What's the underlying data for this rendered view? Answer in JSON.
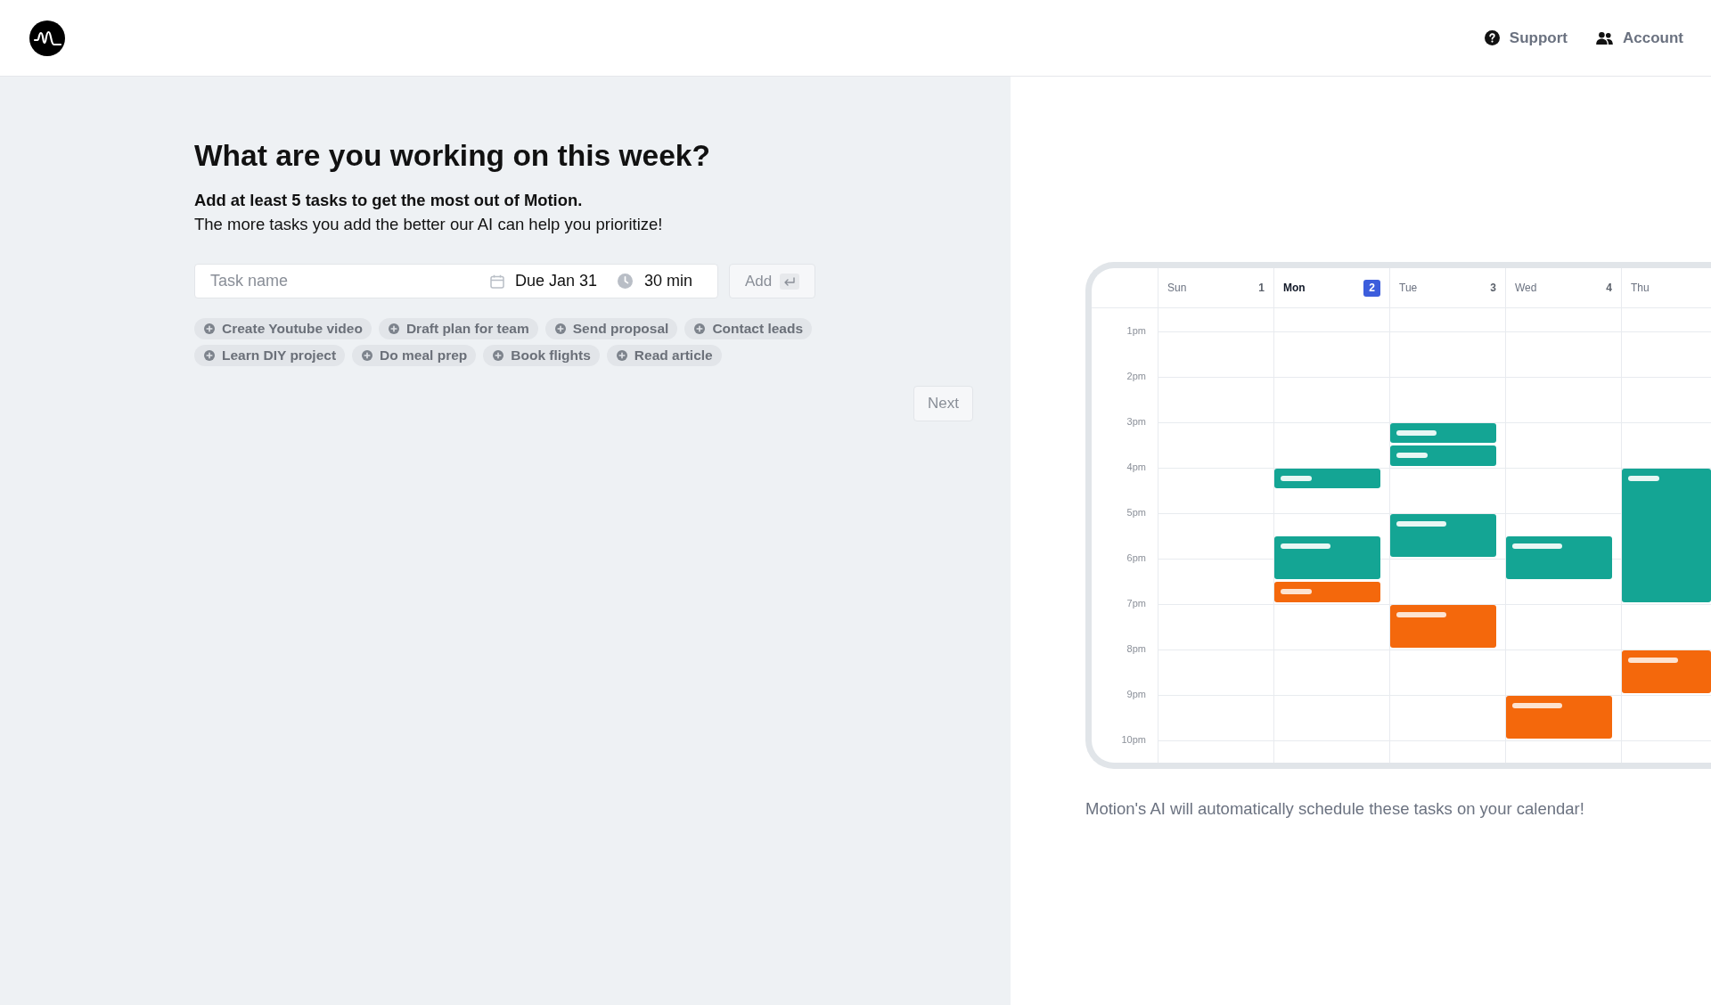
{
  "header": {
    "nav": [
      {
        "kind": "support",
        "label": "Support"
      },
      {
        "kind": "account",
        "label": "Account"
      }
    ]
  },
  "onboarding": {
    "title": "What are you working on this week?",
    "lead": "Add at least 5 tasks to get the most out of Motion.",
    "description": "The more tasks you add the better our AI can help you prioritize!",
    "task_entry": {
      "placeholder": "Task name",
      "due": "Due Jan 31",
      "duration": "30 min",
      "add_button": {
        "label": "Add",
        "disabled": true
      }
    },
    "suggestions": [
      "Create Youtube video",
      "Draft plan for team",
      "Send proposal",
      "Contact leads",
      "Learn DIY project",
      "Do meal prep",
      "Book flights",
      "Read article"
    ],
    "next_button": {
      "label": "Next",
      "disabled": true
    }
  },
  "calendar": {
    "days": [
      {
        "label": "Sun",
        "date": "1",
        "selected": false
      },
      {
        "label": "Mon",
        "date": "2",
        "selected": true
      },
      {
        "label": "Tue",
        "date": "3",
        "selected": false
      },
      {
        "label": "Wed",
        "date": "4",
        "selected": false
      },
      {
        "label": "Thu",
        "selected": false
      }
    ],
    "hours": [
      "1pm",
      "2pm",
      "3pm",
      "4pm",
      "5pm",
      "6pm",
      "7pm",
      "8pm",
      "9pm",
      "10pm"
    ],
    "caption": "Motion's AI will automatically schedule these tasks on your calendar!"
  }
}
